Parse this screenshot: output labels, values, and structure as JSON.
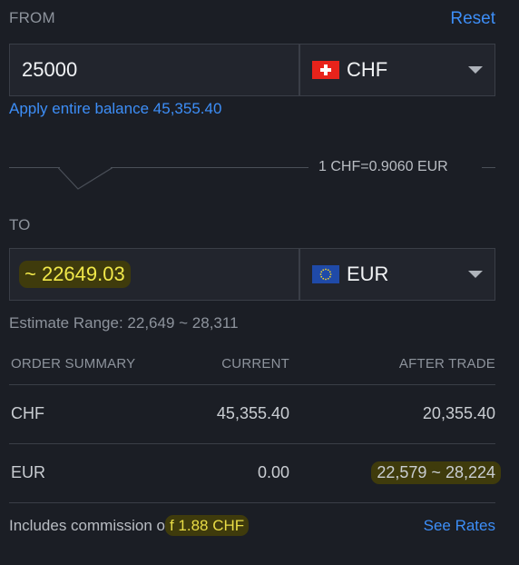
{
  "from": {
    "label": "FROM",
    "reset_label": "Reset",
    "amount_value": "25000",
    "currency_code": "CHF",
    "apply_label": "Apply entire balance",
    "balance": "45,355.40"
  },
  "rate": {
    "text": "1 CHF=0.9060 EUR"
  },
  "to": {
    "label": "TO",
    "amount_value": "~ 22649.03",
    "currency_code": "EUR",
    "estimate_label": "Estimate Range:",
    "estimate_value": "22,649 ~ 28,311"
  },
  "summary": {
    "headers": [
      "ORDER SUMMARY",
      "CURRENT",
      "AFTER TRADE"
    ],
    "rows": [
      {
        "currency": "CHF",
        "current": "45,355.40",
        "after": "20,355.40"
      },
      {
        "currency": "EUR",
        "current": "0.00",
        "after": "22,579 ~ 28,224"
      }
    ]
  },
  "footer": {
    "commission_prefix": "Includes commission o",
    "commission_highlight": "f 1.88 CHF",
    "see_rates_label": "See Rates"
  },
  "colors": {
    "background": "#1b1e25",
    "accent_link": "#3d8ef7",
    "highlight_text": "#f1e84a",
    "highlight_bg": "#3f3b0c"
  },
  "icons": {
    "from_flag": "swiss-flag-icon",
    "to_flag": "eu-flag-icon",
    "dropdown": "chevron-down-icon"
  }
}
